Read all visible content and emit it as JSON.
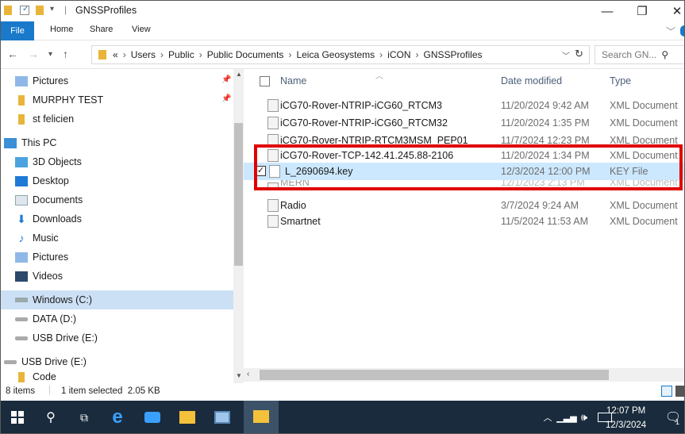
{
  "window": {
    "title": "GNSSProfiles",
    "controls": {
      "minimize": "—",
      "maximize": "❐",
      "close": "✕"
    }
  },
  "ribbon": {
    "tabs": [
      "File",
      "Home",
      "Share",
      "View"
    ]
  },
  "address": {
    "path": [
      "«",
      "Users",
      "Public",
      "Public Documents",
      "Leica Geosystems",
      "iCON",
      "GNSSProfiles"
    ],
    "search_placeholder": "Search GN..."
  },
  "nav": {
    "items": [
      {
        "label": "Pictures",
        "icon": "pictures-icon"
      },
      {
        "label": "MURPHY TEST",
        "icon": "folder-icon"
      },
      {
        "label": "st felicien",
        "icon": "folder-icon"
      },
      {
        "label": "This PC",
        "icon": "this-pc-icon"
      },
      {
        "label": "3D Objects",
        "icon": "3d-objects-icon"
      },
      {
        "label": "Desktop",
        "icon": "desktop-icon"
      },
      {
        "label": "Documents",
        "icon": "documents-icon"
      },
      {
        "label": "Downloads",
        "icon": "downloads-icon"
      },
      {
        "label": "Music",
        "icon": "music-icon"
      },
      {
        "label": "Pictures",
        "icon": "pictures-icon"
      },
      {
        "label": "Videos",
        "icon": "videos-icon"
      },
      {
        "label": "Windows (C:)",
        "icon": "drive-c-icon"
      },
      {
        "label": "DATA (D:)",
        "icon": "drive-icon"
      },
      {
        "label": "USB Drive (E:)",
        "icon": "usb-drive-icon"
      },
      {
        "label": "USB Drive (E:)",
        "icon": "usb-drive-icon"
      },
      {
        "label": "Code",
        "icon": "folder-icon"
      }
    ]
  },
  "list": {
    "headers": {
      "name": "Name",
      "date": "Date modified",
      "type": "Type"
    },
    "rows": [
      {
        "name": "iCG70-Rover-NTRIP-iCG60_RTCM3",
        "date": "11/20/2024 9:42 AM",
        "type": "XML Document"
      },
      {
        "name": "iCG70-Rover-NTRIP-iCG60_RTCM32",
        "date": "11/20/2024 1:35 PM",
        "type": "XML Document"
      },
      {
        "name": "iCG70-Rover-NTRIP-RTCM3MSM_PEP01",
        "date": "11/7/2024 12:23 PM",
        "type": "XML Document"
      },
      {
        "name": "iCG70-Rover-TCP-142.41.245.88-2106",
        "date": "11/20/2024 1:34 PM",
        "type": "XML Document"
      },
      {
        "name": "L_2690694.key",
        "date": "12/3/2024 12:00 PM",
        "type": "KEY File"
      },
      {
        "name": "MERN",
        "date": "12/1/2023 2:13 PM",
        "type": "XML Document"
      },
      {
        "name": "Radio",
        "date": "3/7/2024 9:24 AM",
        "type": "XML Document"
      },
      {
        "name": "Smartnet",
        "date": "11/5/2024 11:53 AM",
        "type": "XML Document"
      }
    ]
  },
  "status": {
    "items": "8 items",
    "selected": "1 item selected  2.05 KB"
  },
  "taskbar": {
    "time": "12:07 PM",
    "date": "12/3/2024",
    "notifications": "1"
  },
  "colors": {
    "accent": "#1979ca",
    "selection": "#cce8ff",
    "highlight_box": "#e00000",
    "taskbar": "#1a2b3d"
  }
}
